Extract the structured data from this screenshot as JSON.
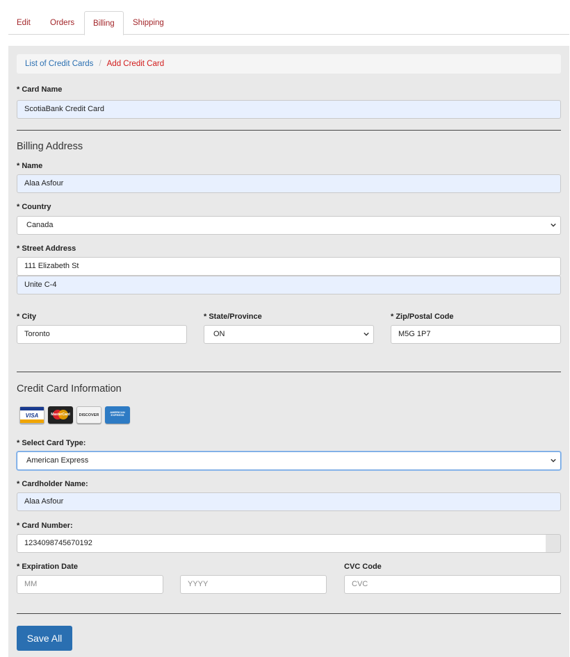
{
  "tabs": [
    {
      "label": "Edit"
    },
    {
      "label": "Orders"
    },
    {
      "label": "Billing"
    },
    {
      "label": "Shipping"
    }
  ],
  "breadcrumb": {
    "parent": "List of Credit Cards",
    "separator": "/",
    "current": "Add Credit Card"
  },
  "card_name": {
    "label": "* Card Name",
    "value": "ScotiaBank Credit Card"
  },
  "billing": {
    "title": "Billing Address",
    "name": {
      "label": "* Name",
      "value": "Alaa Asfour"
    },
    "country": {
      "label": "* Country",
      "value": "Canada"
    },
    "street": {
      "label": "* Street Address",
      "line1": "111 Elizabeth St",
      "line2": "Unite C-4"
    },
    "city": {
      "label": "* City",
      "value": "Toronto"
    },
    "state": {
      "label": "* State/Province",
      "value": "ON"
    },
    "zip": {
      "label": "* Zip/Postal Code",
      "value": "M5G 1P7"
    }
  },
  "credit": {
    "title": "Credit Card Information",
    "logos": [
      {
        "name": "VISA",
        "color": "#1a3b8f"
      },
      {
        "name": "MasterCard",
        "color": "#e8a400"
      },
      {
        "name": "DISCOVER",
        "color": "#f47216"
      },
      {
        "name": "AMERICAN EXPRESS",
        "color": "#2e7bc4"
      }
    ],
    "card_type": {
      "label": "* Select Card Type:",
      "value": "American Express"
    },
    "holder": {
      "label": "* Cardholder Name:",
      "value": "Alaa Asfour"
    },
    "number": {
      "label": "* Card Number:",
      "value": "1234098745670192"
    },
    "expiry": {
      "label": "* Expiration Date",
      "month_placeholder": "MM",
      "year_placeholder": "YYYY"
    },
    "cvc": {
      "label": "CVC Code",
      "placeholder": "CVC"
    }
  },
  "save_label": "Save All",
  "colors": {
    "accent": "#2a6fb1",
    "tab_text": "#a3262a",
    "autofill": "#e8f0fe"
  }
}
